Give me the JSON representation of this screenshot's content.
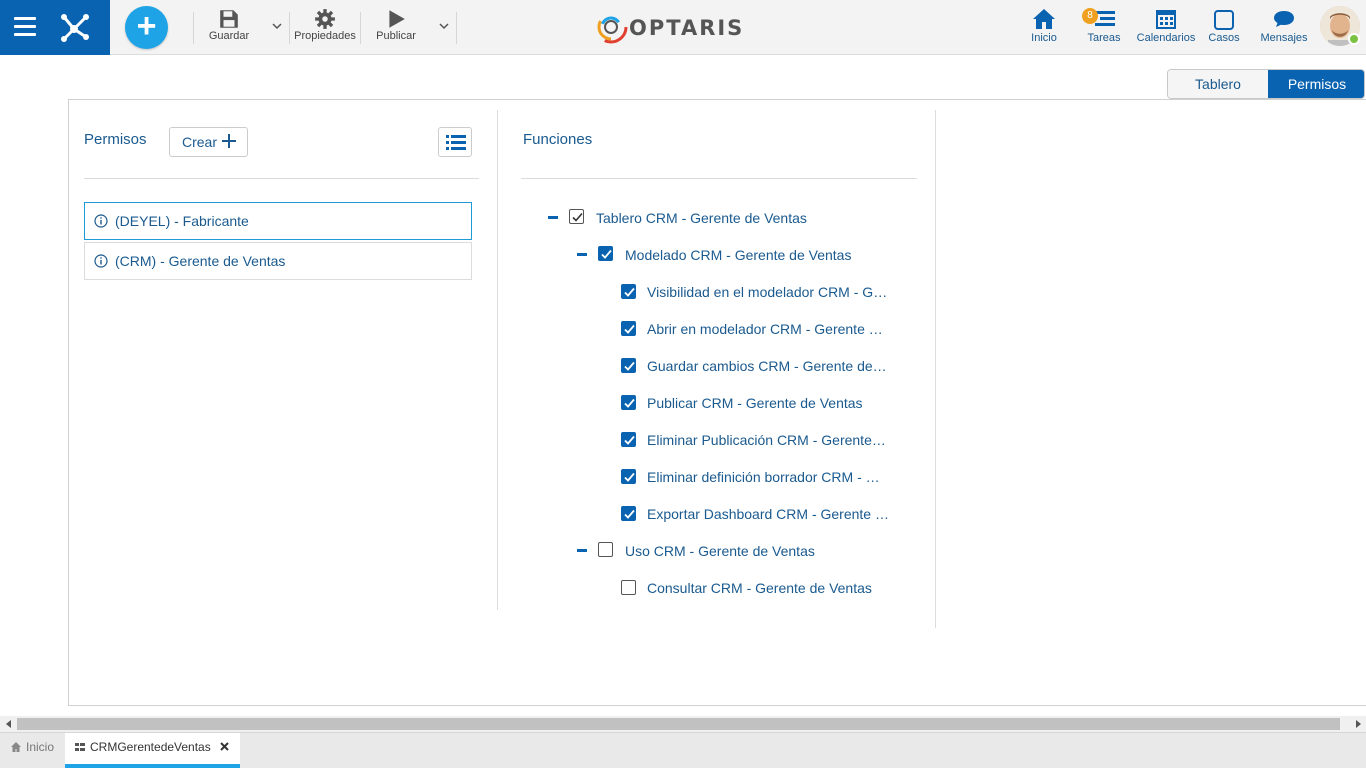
{
  "toolbar": {
    "save_label": "Guardar",
    "properties_label": "Propiedades",
    "publish_label": "Publicar"
  },
  "logo_text": "OPTARIS",
  "nav": {
    "home_label": "Inicio",
    "tasks_label": "Tareas",
    "tasks_badge": "8",
    "calendars_label": "Calendarios",
    "cases_label": "Casos",
    "messages_label": "Mensajes"
  },
  "view_toggle": {
    "tablero_label": "Tablero",
    "permisos_label": "Permisos",
    "active": "Permisos"
  },
  "permissions": {
    "title": "Permisos",
    "create_label": "Crear",
    "items": [
      {
        "label": "(DEYEL) - Fabricante",
        "selected": true
      },
      {
        "label": "(CRM) - Gerente de Ventas",
        "selected": false
      }
    ]
  },
  "functions": {
    "title": "Funciones",
    "tree": [
      {
        "label": "Tablero CRM - Gerente de Ventas",
        "level": 0,
        "collapsible": true,
        "checked": "partial"
      },
      {
        "label": "Modelado CRM - Gerente de Ventas",
        "level": 1,
        "collapsible": true,
        "checked": true
      },
      {
        "label": "Visibilidad en el modelador CRM - Gerente de Ventas",
        "level": 2,
        "checked": true
      },
      {
        "label": "Abrir en modelador CRM - Gerente de Ventas",
        "level": 2,
        "checked": true
      },
      {
        "label": "Guardar cambios CRM - Gerente de Ventas",
        "level": 2,
        "checked": true
      },
      {
        "label": "Publicar CRM - Gerente de Ventas",
        "level": 2,
        "checked": true
      },
      {
        "label": "Eliminar Publicación CRM - Gerente de Ventas",
        "level": 2,
        "checked": true
      },
      {
        "label": "Eliminar definición borrador CRM - Gerente de Ventas",
        "level": 2,
        "checked": true
      },
      {
        "label": "Exportar Dashboard CRM - Gerente de Ventas",
        "level": 2,
        "checked": true
      },
      {
        "label": "Uso CRM - Gerente de Ventas",
        "level": 1,
        "collapsible": true,
        "checked": false
      },
      {
        "label": "Consultar CRM - Gerente de Ventas",
        "level": 2,
        "checked": false
      }
    ]
  },
  "bottom_tabs": {
    "home_label": "Inicio",
    "doc_label": "CRMGerentedeVentas"
  },
  "colors": {
    "primary": "#0a63b0",
    "accent": "#1ea4e6",
    "text": "#1a5a8f",
    "badge": "#f0a020",
    "online": "#7cc242"
  }
}
